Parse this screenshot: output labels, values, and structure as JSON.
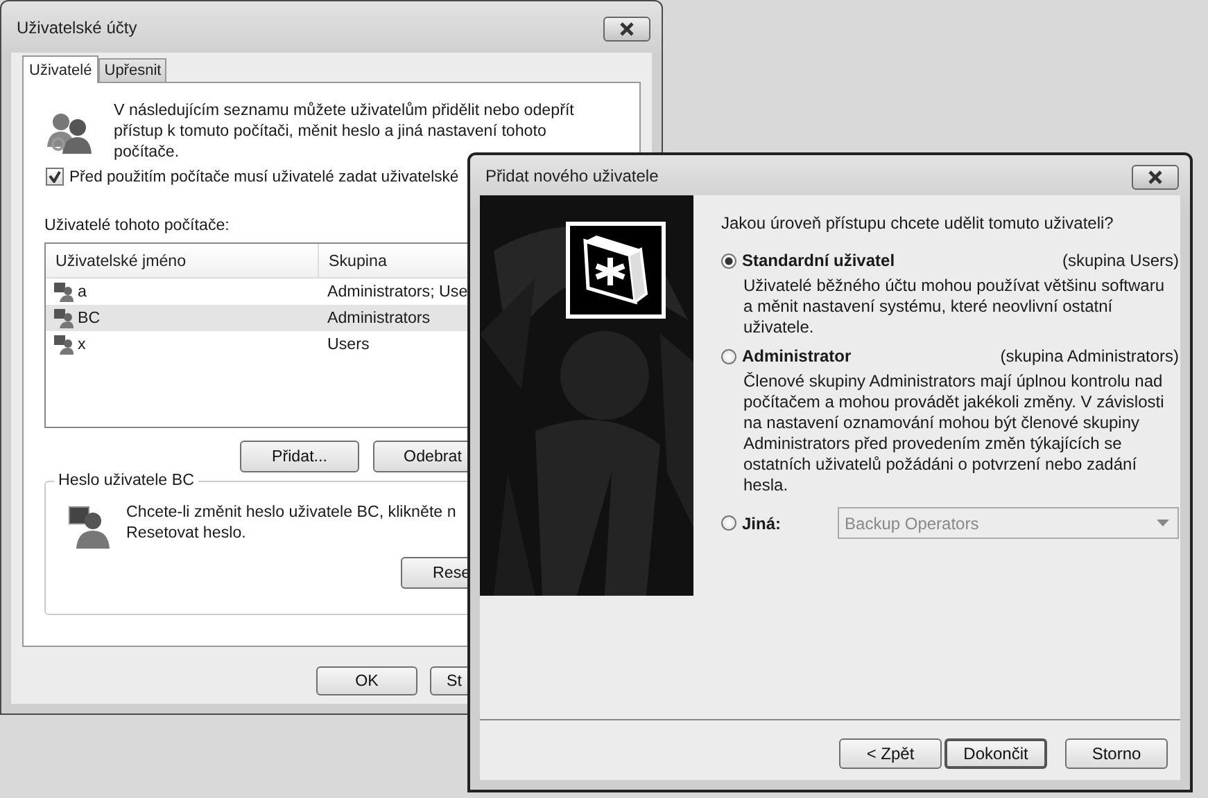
{
  "user_accounts": {
    "title": "Uživatelské účty",
    "tabs": [
      {
        "label": "Uživatelé",
        "selected": true
      },
      {
        "label": "Upřesnit",
        "selected": false
      }
    ],
    "intro": "V následujícím seznamu můžete uživatelům přidělit nebo odepřít přístup k tomuto počítači, měnit heslo a jiná nastavení tohoto počítače.",
    "login_checkbox": {
      "label": "Před použitím počítače musí uživatelé zadat uživatelské",
      "checked": true
    },
    "list_label": "Uživatelé tohoto počítače:",
    "table": {
      "columns": [
        "Uživatelské jméno",
        "Skupina"
      ],
      "rows": [
        {
          "cells": [
            "a",
            "Administrators; Use"
          ],
          "selected": false
        },
        {
          "cells": [
            "BC",
            "Administrators"
          ],
          "selected": true
        },
        {
          "cells": [
            "x",
            "Users"
          ],
          "selected": false
        }
      ]
    },
    "list_buttons": [
      "Přidat...",
      "Odebrat"
    ],
    "password_group": {
      "title": "Heslo uživatele BC",
      "lines": [
        "Chcete-li změnit heslo uživatele BC, klikněte n",
        "Resetovat heslo."
      ],
      "button": "Rese"
    },
    "buttons": [
      "OK",
      "St"
    ]
  },
  "add_user_wizard": {
    "title": "Přidat nového uživatele",
    "question": "Jakou úroveň přístupu chcete udělit tomuto uživateli?",
    "options": [
      {
        "kind": "level",
        "label": "Standardní uživatel",
        "group": "(skupina Users)",
        "description": "Uživatelé běžného účtu mohou používat většinu softwaru a měnit nastavení systému, které neovlivní ostatní uživatele.",
        "selected": true
      },
      {
        "kind": "level",
        "label": "Administrator",
        "group": "(skupina Administrators)",
        "description": "Členové skupiny Administrators mají úplnou kontrolu nad počítačem a mohou provádět jakékoli změny. V závislosti na nastavení oznamování mohou být členové skupiny Administrators před provedením změn týkajících se ostatních uživatelů požádáni o potvrzení nebo zadání hesla.",
        "selected": false
      },
      {
        "kind": "other",
        "label": "Jiná:",
        "dropdown": {
          "value": "Backup Operators",
          "disabled": true
        },
        "selected": false
      }
    ],
    "buttons": [
      {
        "label": "< Zpět",
        "default": false
      },
      {
        "label": "Dokončit",
        "default": true
      },
      {
        "label": "Storno",
        "default": false
      }
    ]
  }
}
